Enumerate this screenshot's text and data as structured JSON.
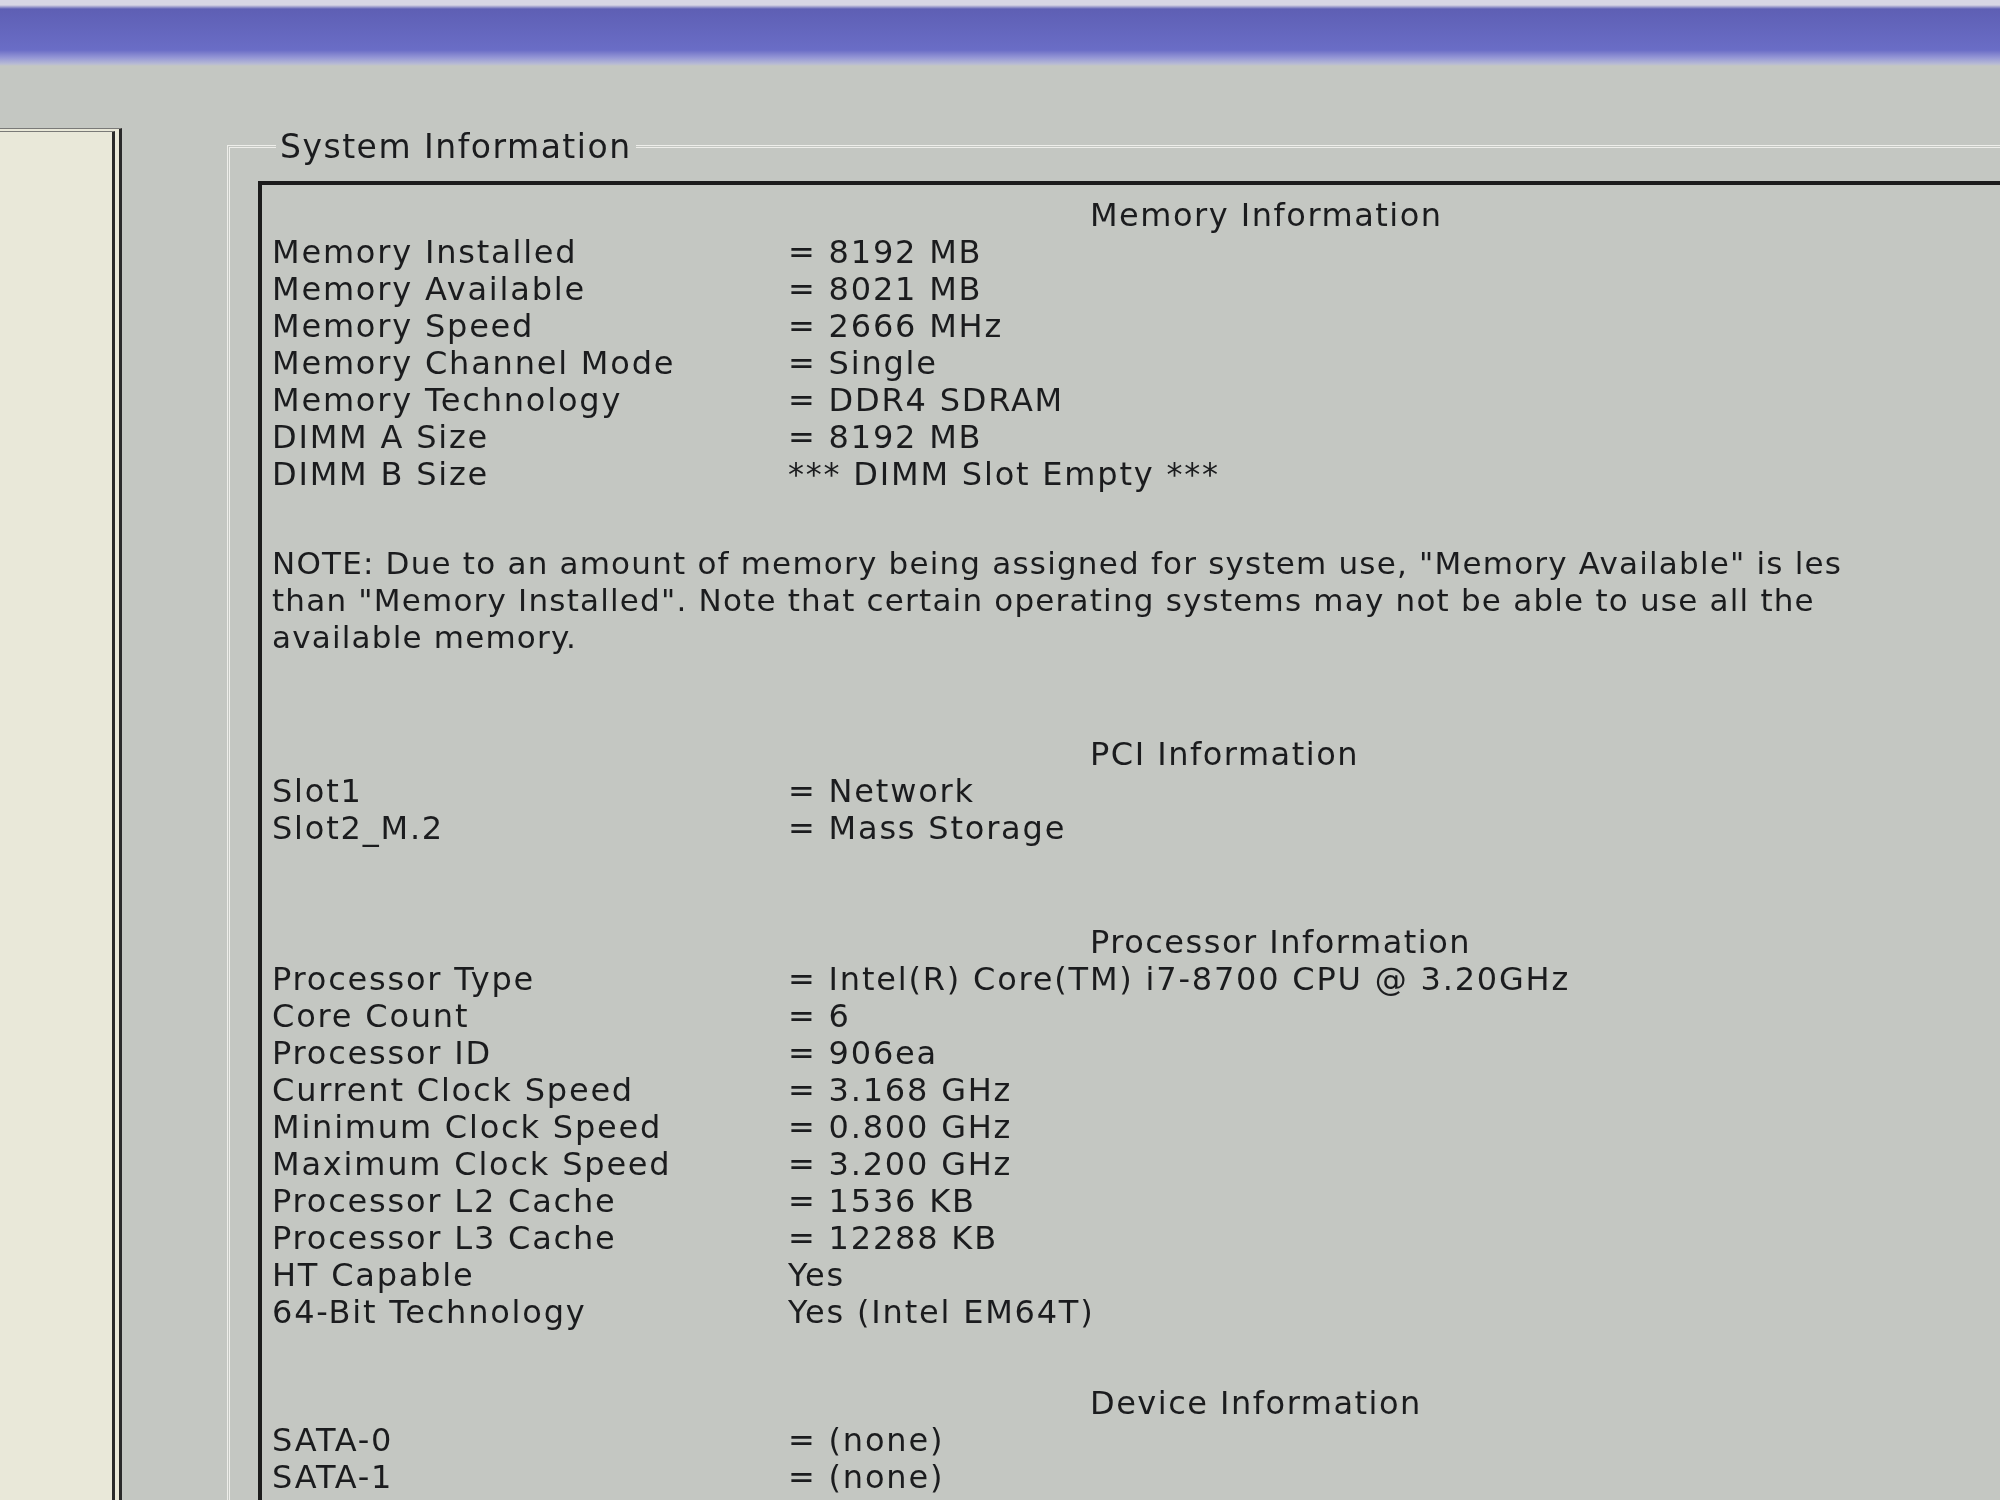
{
  "group": {
    "title": "System Information",
    "sections": [
      {
        "heading": "Memory Information",
        "rows": [
          {
            "label": "Memory Installed",
            "value": "= 8192 MB"
          },
          {
            "label": "Memory Available",
            "value": "= 8021 MB"
          },
          {
            "label": "Memory Speed",
            "value": "= 2666 MHz"
          },
          {
            "label": "Memory Channel Mode",
            "value": "= Single"
          },
          {
            "label": "Memory Technology",
            "value": "= DDR4 SDRAM"
          },
          {
            "label": "DIMM A Size",
            "value": "= 8192 MB"
          },
          {
            "label": "DIMM B Size",
            "value": "*** DIMM Slot Empty ***"
          }
        ],
        "note_lines": [
          "NOTE: Due to an amount of memory being assigned for system use, \"Memory Available\" is les",
          "than \"Memory Installed\". Note that certain operating systems may not be able to use all the",
          "available memory."
        ]
      },
      {
        "heading": "PCI Information",
        "rows": [
          {
            "label": "Slot1",
            "value": "= Network"
          },
          {
            "label": "Slot2_M.2",
            "value": "= Mass Storage"
          }
        ]
      },
      {
        "heading": "Processor Information",
        "rows": [
          {
            "label": "Processor Type",
            "value": "= Intel(R) Core(TM) i7-8700 CPU @ 3.20GHz"
          },
          {
            "label": "Core Count",
            "value": "= 6"
          },
          {
            "label": "Processor ID",
            "value": "= 906ea"
          },
          {
            "label": "Current Clock Speed",
            "value": "= 3.168 GHz"
          },
          {
            "label": "Minimum Clock Speed",
            "value": "= 0.800 GHz"
          },
          {
            "label": "Maximum Clock Speed",
            "value": "= 3.200 GHz"
          },
          {
            "label": "Processor L2 Cache",
            "value": "= 1536 KB"
          },
          {
            "label": "Processor L3 Cache",
            "value": "= 12288 KB"
          },
          {
            "label": "HT Capable",
            "value": "Yes"
          },
          {
            "label": "64-Bit Technology",
            "value": "Yes (Intel EM64T)"
          }
        ]
      },
      {
        "heading": "Device Information",
        "rows": [
          {
            "label": "SATA-0",
            "value": "= (none)"
          },
          {
            "label": "SATA-1",
            "value": "= (none)"
          }
        ]
      }
    ]
  }
}
